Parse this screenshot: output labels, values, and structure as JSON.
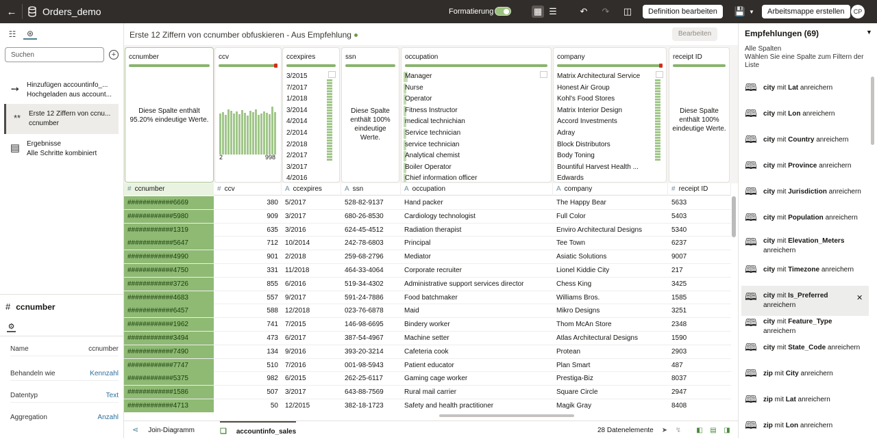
{
  "topbar": {
    "title": "Orders_demo",
    "format_label": "Formatierung",
    "edit_definition": "Definition bearbeiten",
    "create_workbook": "Arbeitsmappe erstellen",
    "avatar": "CP"
  },
  "left": {
    "search_placeholder": "Suchen",
    "steps": [
      {
        "line1": "Hinzufügen accountinfo_...",
        "line2": "Hochgeladen aus account..."
      },
      {
        "line1": "Erste 12 Ziffern von ccnu...",
        "line2": "ccnumber"
      },
      {
        "line1": "Ergebnisse",
        "line2": "Alle Schritte kombiniert"
      }
    ],
    "props": {
      "type_icon": "#",
      "title": "ccnumber",
      "rows": [
        {
          "key": "Name",
          "value": "ccnumber"
        },
        {
          "key": "Behandeln wie",
          "value": "Kennzahl"
        },
        {
          "key": "Datentyp",
          "value": "Text"
        },
        {
          "key": "Aggregation",
          "value": "Anzahl"
        }
      ]
    }
  },
  "center": {
    "title": "Erste 12 Ziffern von ccnumber obfuskieren - Aus Empfehlung",
    "edit_button": "Bearbeiten",
    "cards": {
      "ccnumber": {
        "name": "ccnumber",
        "message": "Diese Spalte enthält 95.20% eindeutige Werte."
      },
      "ccv": {
        "name": "ccv",
        "min": "2",
        "max": "998"
      },
      "ccexpires": {
        "name": "ccexpires",
        "values": [
          "3/2015",
          "7/2017",
          "1/2018",
          "3/2014",
          "4/2014",
          "2/2014",
          "2/2018",
          "2/2017",
          "3/2017",
          "4/2016"
        ]
      },
      "ssn": {
        "name": "ssn",
        "message": "Diese Spalte enthält 100% eindeutige Werte."
      },
      "occupation": {
        "name": "occupation",
        "values": [
          "Manager",
          "Nurse",
          "Operator",
          "Fitness Instructor",
          "medical technichian",
          "Service technician",
          "service technician",
          "Analytical chemist",
          "Boiler Operator",
          "Chief information officer"
        ]
      },
      "company": {
        "name": "company",
        "values": [
          "Matrix Architectural Service",
          "Honest Air Group",
          "Kohl's Food Stores",
          "Matrix Interior Design",
          "Accord Investments",
          "Adray",
          "Block Distributors",
          "Body Toning",
          "Bountiful Harvest Health ...",
          "Edwards"
        ]
      },
      "receipt": {
        "name": "receipt ID",
        "message": "Diese Spalte enthält 100% eindeutige Werte."
      }
    },
    "columns": [
      {
        "type": "#",
        "name": "ccnumber"
      },
      {
        "type": "#",
        "name": "ccv"
      },
      {
        "type": "A",
        "name": "ccexpires"
      },
      {
        "type": "A",
        "name": "ssn"
      },
      {
        "type": "A",
        "name": "occupation"
      },
      {
        "type": "A",
        "name": "company"
      },
      {
        "type": "#",
        "name": "receipt ID"
      }
    ],
    "rows": [
      [
        "############6669",
        "380",
        "5/2017",
        "528-82-9137",
        "Hand packer",
        "The Happy Bear",
        "5633"
      ],
      [
        "############5980",
        "909",
        "3/2017",
        "680-26-8530",
        "Cardiology technologist",
        "Full Color",
        "5403"
      ],
      [
        "############1319",
        "635",
        "3/2016",
        "624-45-4512",
        "Radiation therapist",
        "Enviro Architectural Designs",
        "5340"
      ],
      [
        "############5647",
        "712",
        "10/2014",
        "242-78-6803",
        "Principal",
        "Tee Town",
        "6237"
      ],
      [
        "############4990",
        "901",
        "2/2018",
        "259-68-2796",
        "Mediator",
        "Asiatic Solutions",
        "9007"
      ],
      [
        "############4750",
        "331",
        "11/2018",
        "464-33-4064",
        "Corporate recruiter",
        "Lionel Kiddie City",
        "217"
      ],
      [
        "############3726",
        "855",
        "6/2016",
        "519-34-4302",
        "Administrative support services director",
        "Chess King",
        "3425"
      ],
      [
        "############4683",
        "557",
        "9/2017",
        "591-24-7886",
        "Food batchmaker",
        "Williams Bros.",
        "1585"
      ],
      [
        "############6457",
        "588",
        "12/2018",
        "023-76-6878",
        "Maid",
        "Mikro Designs",
        "3251"
      ],
      [
        "############1962",
        "741",
        "7/2015",
        "146-98-6695",
        "Bindery worker",
        "Thom McAn Store",
        "2348"
      ],
      [
        "############3494",
        "473",
        "6/2017",
        "387-54-4967",
        "Machine setter",
        "Atlas Architectural Designs",
        "1590"
      ],
      [
        "############7490",
        "134",
        "9/2016",
        "393-20-3214",
        "Cafeteria cook",
        "Protean",
        "2903"
      ],
      [
        "############7747",
        "510",
        "7/2016",
        "001-98-5943",
        "Patient educator",
        "Plan Smart",
        "487"
      ],
      [
        "############5375",
        "982",
        "6/2015",
        "262-25-6117",
        "Gaming cage worker",
        "Prestiga-Biz",
        "8037"
      ],
      [
        "############1586",
        "507",
        "3/2017",
        "643-88-7569",
        "Rural mail carrier",
        "Square Circle",
        "2947"
      ],
      [
        "############4713",
        "50",
        "12/2015",
        "382-18-1723",
        "Safety and health practitioner",
        "Magik Gray",
        "8408"
      ]
    ],
    "bottom": {
      "tab1": "Join-Diagramm",
      "tab2": "accountinfo_sales",
      "count": "28 Datenelemente"
    }
  },
  "right": {
    "title": "Empfehlungen (69)",
    "subtitle": "Alle Spalten\nWählen Sie eine Spalte zum Filtern der Liste",
    "items": [
      {
        "a": "city",
        "m": " mit ",
        "b": "Lat",
        "e": " anreichern"
      },
      {
        "a": "city",
        "m": " mit ",
        "b": "Lon",
        "e": " anreichern"
      },
      {
        "a": "city",
        "m": " mit ",
        "b": "Country",
        "e": " anreichern"
      },
      {
        "a": "city",
        "m": " mit ",
        "b": "Province",
        "e": " anreichern"
      },
      {
        "a": "city",
        "m": " mit ",
        "b": "Jurisdiction",
        "e": " anreichern"
      },
      {
        "a": "city",
        "m": " mit ",
        "b": "Population",
        "e": " anreichern"
      },
      {
        "a": "city",
        "m": " mit ",
        "b": "Elevation_Meters",
        "e": " anreichern"
      },
      {
        "a": "city",
        "m": " mit ",
        "b": "Timezone",
        "e": " anreichern"
      },
      {
        "a": "city",
        "m": " mit ",
        "b": "Is_Preferred",
        "e": " anreichern"
      },
      {
        "a": "city",
        "m": " mit ",
        "b": "Feature_Type",
        "e": " anreichern"
      },
      {
        "a": "city",
        "m": " mit ",
        "b": "State_Code",
        "e": " anreichern"
      },
      {
        "a": "zip",
        "m": " mit ",
        "b": "City",
        "e": " anreichern"
      },
      {
        "a": "zip",
        "m": " mit ",
        "b": "Lat",
        "e": " anreichern"
      },
      {
        "a": "zip",
        "m": " mit ",
        "b": "Lon",
        "e": " anreichern"
      }
    ]
  },
  "colors": {
    "topbar": "#312d2a",
    "accent_green": "#8fba74",
    "quality_red": "#d02f1b"
  }
}
